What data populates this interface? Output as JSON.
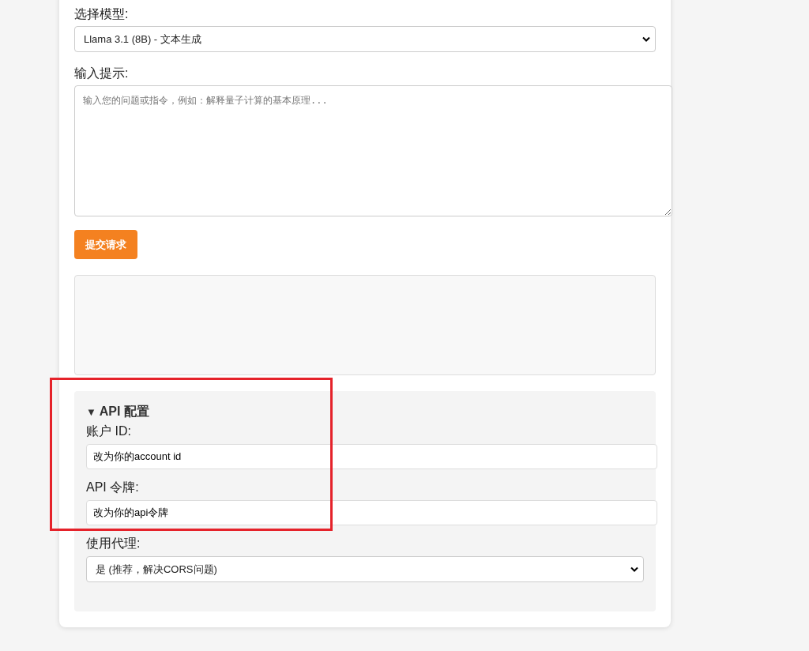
{
  "model_field": {
    "label": "选择模型:",
    "value": "Llama 3.1 (8B) - 文本生成"
  },
  "prompt_field": {
    "label": "输入提示:",
    "placeholder": "输入您的问题或指令，例如：解释量子计算的基本原理..."
  },
  "submit_button": {
    "label": "提交请求"
  },
  "api_config": {
    "toggle": "▼",
    "title": "API 配置",
    "expanded": true,
    "fields": [
      {
        "kind": "text",
        "label": "账户 ID:",
        "value": "改为你的account id"
      },
      {
        "kind": "text",
        "label": "API 令牌:",
        "value": "改为你的api令牌"
      },
      {
        "kind": "select",
        "label": "使用代理:",
        "value": "是 (推荐，解决CORS问题)"
      }
    ]
  }
}
